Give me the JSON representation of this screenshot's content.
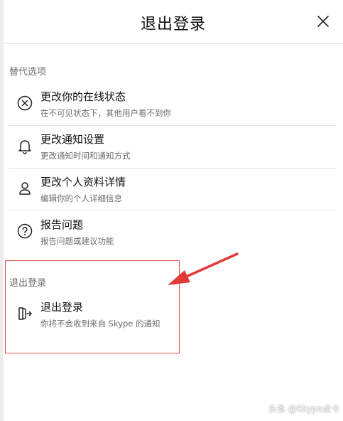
{
  "dialog": {
    "title": "退出登录"
  },
  "alternatives": {
    "label": "替代选项",
    "items": [
      {
        "title": "更改你的在线状态",
        "subtitle": "在不可见状态下，其他用户看不到你",
        "icon": "status-x-icon"
      },
      {
        "title": "更改通知设置",
        "subtitle": "更改通知时间和通知方式",
        "icon": "bell-icon"
      },
      {
        "title": "更改个人资料详情",
        "subtitle": "编辑你的个人详细信息",
        "icon": "person-icon"
      },
      {
        "title": "报告问题",
        "subtitle": "报告问题或建议功能",
        "icon": "question-icon"
      }
    ]
  },
  "signout": {
    "label": "退出登录",
    "item": {
      "title": "退出登录",
      "subtitle": "你将不会收到来自 Skype 的通知",
      "icon": "sign-out-icon"
    }
  },
  "annotation": {
    "box_color": "#e04a4a",
    "arrow_color": "#e23a3a"
  },
  "watermark": "头条 @Skype点卡"
}
